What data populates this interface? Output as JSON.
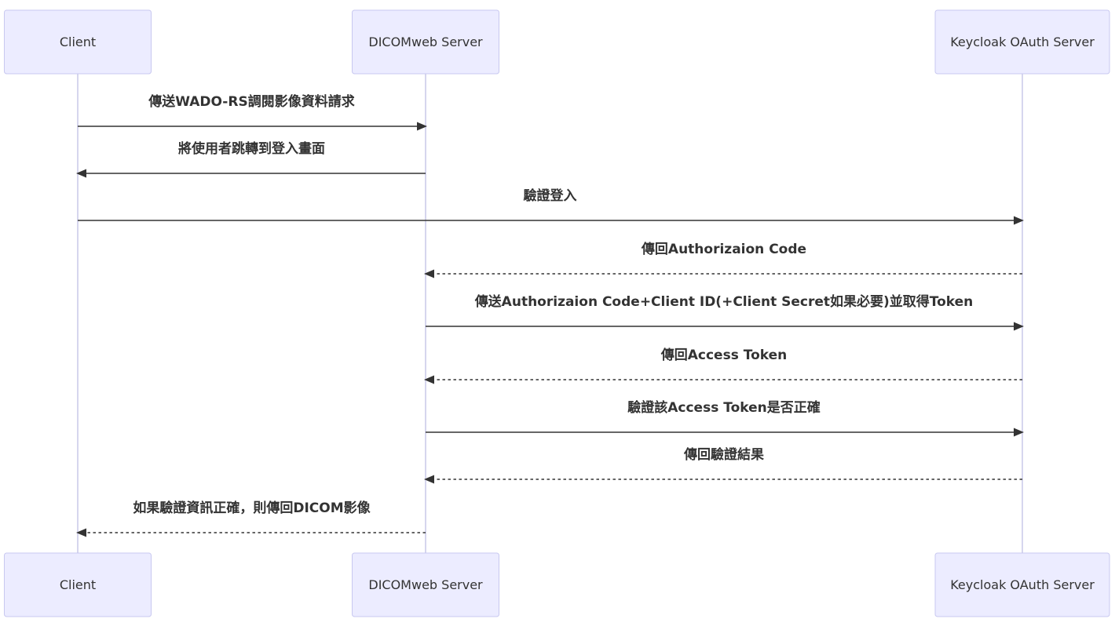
{
  "participants": [
    {
      "id": "client",
      "label": "Client"
    },
    {
      "id": "dicomweb",
      "label": "DICOMweb Server"
    },
    {
      "id": "keycloak",
      "label": "Keycloak OAuth Server"
    }
  ],
  "messages": [
    {
      "from": "client",
      "to": "dicomweb",
      "text": "傳送WADO-RS調閱影像資料請求",
      "style": "solid"
    },
    {
      "from": "dicomweb",
      "to": "client",
      "text": "將使用者跳轉到登入畫面",
      "style": "solid"
    },
    {
      "from": "client",
      "to": "keycloak",
      "text": "驗證登入",
      "style": "solid"
    },
    {
      "from": "keycloak",
      "to": "dicomweb",
      "text": "傳回Authorizaion Code",
      "style": "dashed"
    },
    {
      "from": "dicomweb",
      "to": "keycloak",
      "text": "傳送Authorizaion Code+Client ID(+Client Secret如果必要)並取得Token",
      "style": "solid"
    },
    {
      "from": "keycloak",
      "to": "dicomweb",
      "text": "傳回Access Token",
      "style": "dashed"
    },
    {
      "from": "dicomweb",
      "to": "keycloak",
      "text": "驗證該Access Token是否正確",
      "style": "solid"
    },
    {
      "from": "keycloak",
      "to": "dicomweb",
      "text": "傳回驗證結果",
      "style": "dashed"
    },
    {
      "from": "dicomweb",
      "to": "client",
      "text": "如果驗證資訊正確，則傳回DICOM影像",
      "style": "dashed"
    }
  ],
  "colors": {
    "actor_fill": "#ececff",
    "actor_border": "#c8c8f0",
    "lifeline": "#d6d6ee",
    "line": "#333333"
  }
}
